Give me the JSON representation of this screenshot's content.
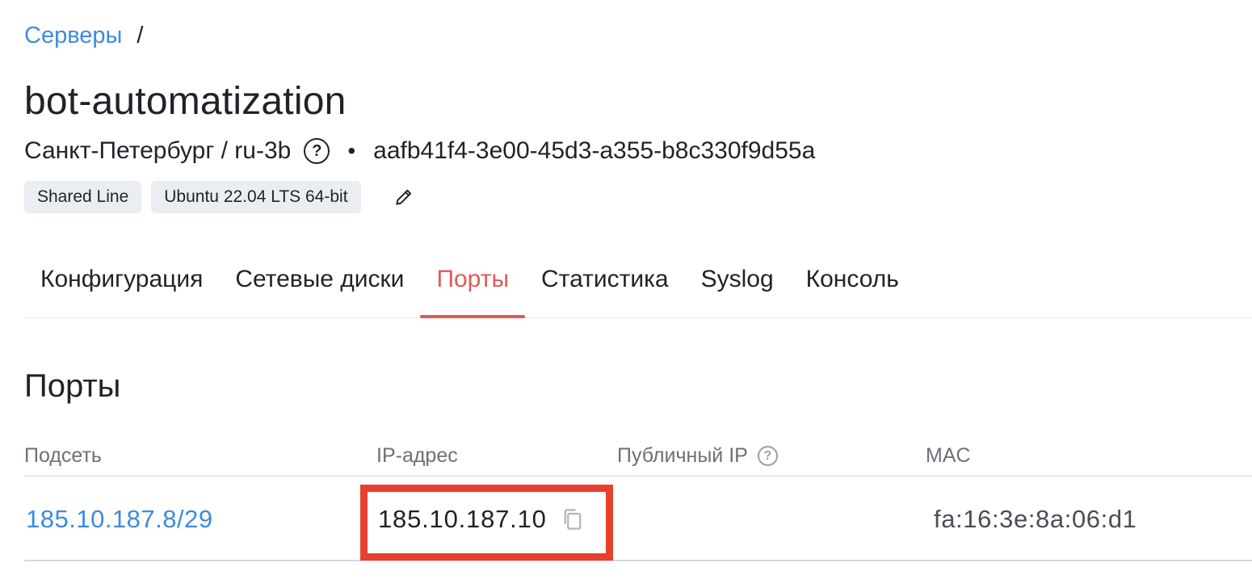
{
  "breadcrumb": {
    "link": "Серверы",
    "separator": "/"
  },
  "server": {
    "name": "bot-automatization",
    "location": "Санкт-Петербург / ru-3b",
    "help_symbol": "?",
    "bullet": "•",
    "uuid": "aafb41f4-3e00-45d3-a355-b8c330f9d55a",
    "tags": [
      "Shared Line",
      "Ubuntu 22.04 LTS 64-bit"
    ]
  },
  "tabs": [
    {
      "label": "Конфигурация",
      "active": false
    },
    {
      "label": "Сетевые диски",
      "active": false
    },
    {
      "label": "Порты",
      "active": true
    },
    {
      "label": "Статистика",
      "active": false
    },
    {
      "label": "Syslog",
      "active": false
    },
    {
      "label": "Консоль",
      "active": false
    }
  ],
  "ports": {
    "title": "Порты",
    "columns": {
      "subnet": "Подсеть",
      "ip": "IP-адрес",
      "public_ip": "Публичный IP",
      "mac": "MAC"
    },
    "help_symbol": "?",
    "rows": [
      {
        "subnet": "185.10.187.8/29",
        "ip": "185.10.187.10",
        "public_ip": "",
        "mac": "fa:16:3e:8a:06:d1"
      }
    ]
  },
  "colors": {
    "link": "#3d8be0",
    "active_tab": "#e05a55",
    "highlight": "#e8402f"
  },
  "icons": {
    "help": "question-circle-icon",
    "edit": "pencil-icon",
    "copy": "copy-icon"
  }
}
